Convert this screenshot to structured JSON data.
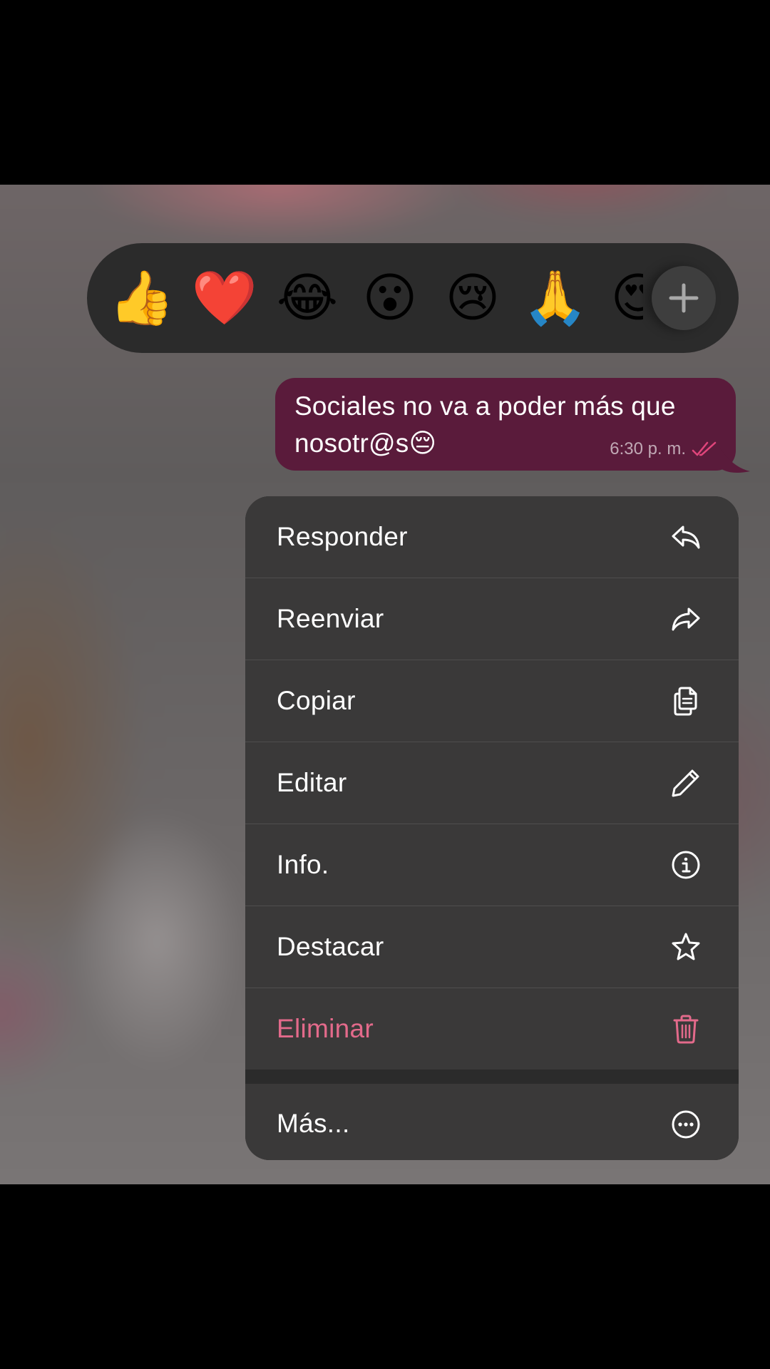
{
  "reactions": [
    "👍",
    "❤️",
    "😂",
    "😮",
    "😢",
    "🙏",
    "😍"
  ],
  "message": {
    "text": "Sociales no va a poder más que nosotr@s😔",
    "time": "6:30 p. m."
  },
  "menu": {
    "items": [
      {
        "label": "Responder",
        "icon": "reply-icon"
      },
      {
        "label": "Reenviar",
        "icon": "forward-icon"
      },
      {
        "label": "Copiar",
        "icon": "copy-icon"
      },
      {
        "label": "Editar",
        "icon": "pencil-icon"
      },
      {
        "label": "Info.",
        "icon": "info-icon"
      },
      {
        "label": "Destacar",
        "icon": "star-icon"
      },
      {
        "label": "Eliminar",
        "icon": "trash-icon"
      }
    ],
    "more": {
      "label": "Más...",
      "icon": "more-icon"
    }
  },
  "colors": {
    "bubble": "#5a1b3b",
    "danger": "#e36a8b",
    "read_receipt": "#e0457b",
    "menu_bg": "#3a3939"
  }
}
